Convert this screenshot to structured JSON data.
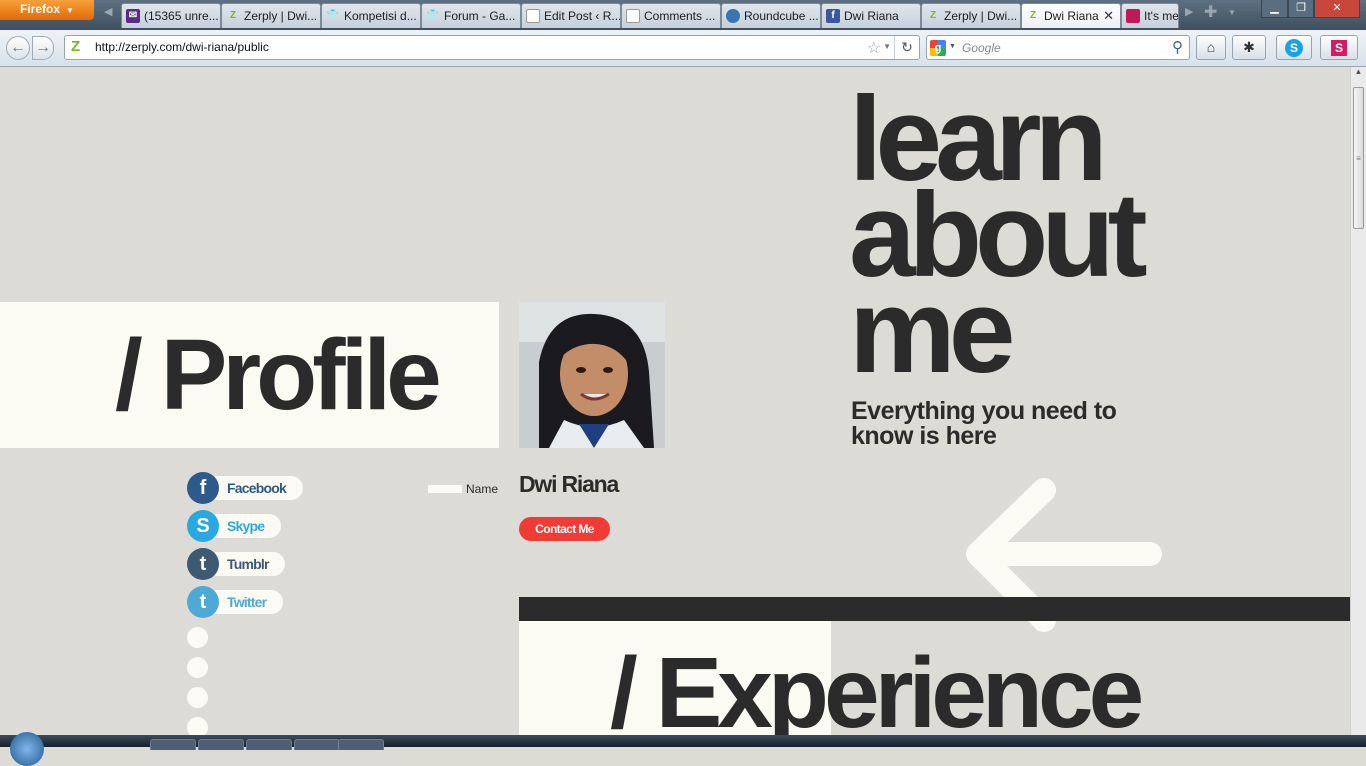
{
  "browser": {
    "menu_button": "Firefox",
    "tabs": [
      {
        "label": "(15365 unre...",
        "icon": "yahoo-mail-icon",
        "color": "#5b2a86"
      },
      {
        "label": "Zerply | Dwi...",
        "icon": "zerply-icon",
        "color": "#7ab51d"
      },
      {
        "label": "Kompetisi d...",
        "icon": "shirt-icon",
        "color": "#e0245e"
      },
      {
        "label": "Forum - Ga...",
        "icon": "shirt-icon",
        "color": "#e0245e"
      },
      {
        "label": "Edit Post ‹ R...",
        "icon": "page-icon",
        "color": "#ffffff"
      },
      {
        "label": "Comments ...",
        "icon": "page-icon",
        "color": "#ffffff"
      },
      {
        "label": "Roundcube ...",
        "icon": "roundcube-icon",
        "color": "#3a75b0"
      },
      {
        "label": "Dwi Riana",
        "icon": "facebook-icon",
        "color": "#3b5998"
      },
      {
        "label": "Zerply | Dwi...",
        "icon": "zerply-icon",
        "color": "#7ab51d"
      },
      {
        "label": "Dwi Riana",
        "icon": "zerply-icon",
        "color": "#7ab51d",
        "active": true
      },
      {
        "label": "It's me",
        "icon": "image-icon",
        "color": "#c2185b"
      }
    ],
    "url": "http://zerply.com/dwi-riana/public",
    "search_placeholder": "Google"
  },
  "hero": {
    "line1": "learn",
    "line2": "about",
    "line3": "me",
    "tagline": "Everything you need to know is here"
  },
  "profile": {
    "section_title": "/ Profile",
    "name_label": "Name",
    "display_name": "Dwi Riana",
    "contact_button": "Contact Me",
    "social": [
      {
        "label": "Facebook",
        "icon": "facebook-icon",
        "color": "#2d5a8b",
        "text_color": "#2d5a8b"
      },
      {
        "label": "Skype",
        "icon": "skype-icon",
        "color": "#2aa9e0",
        "text_color": "#2aa9e0"
      },
      {
        "label": "Tumblr",
        "icon": "tumblr-icon",
        "color": "#3e5a73",
        "text_color": "#3e5a73"
      },
      {
        "label": "Twitter",
        "icon": "twitter-icon",
        "color": "#4fa9d5",
        "text_color": "#4fa9d5"
      }
    ]
  },
  "experience": {
    "section_title": "/ Experience"
  },
  "colors": {
    "background": "#dcdbd6",
    "panel": "#fbfbf4",
    "text_dark": "#2b2b2b",
    "accent_red": "#f13b35"
  }
}
